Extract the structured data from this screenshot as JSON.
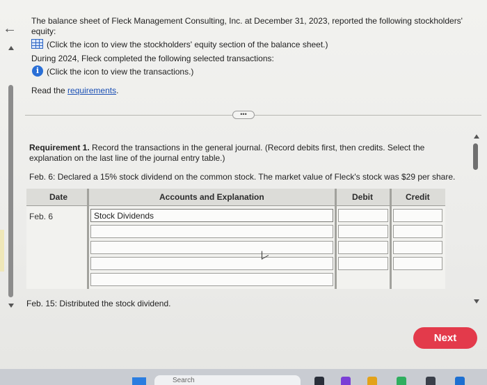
{
  "intro": {
    "line1": "The balance sheet of Fleck Management Consulting, Inc. at December 31, 2023, reported the following stockholders'",
    "line2": "equity:",
    "icon_link1": "(Click the icon to view the stockholders' equity section of the balance sheet.)",
    "line3": "During 2024, Fleck completed the following selected transactions:",
    "icon_link2": "(Click the icon to view the transactions.)",
    "read_prefix": "Read the ",
    "requirements_link": "requirements",
    "read_suffix": "."
  },
  "requirement": {
    "label": "Requirement 1.",
    "text_line1": " Record the transactions in the general journal. (Record debits first, then credits. Select the",
    "text_line2": "explanation on the last line of the journal entry table.)",
    "feb6": "Feb. 6: Declared a 15% stock dividend on the common stock. The market value of Fleck's stock was $29 per share.",
    "feb15": "Feb. 15: Distributed the stock dividend."
  },
  "table": {
    "headers": {
      "date": "Date",
      "accounts": "Accounts and Explanation",
      "debit": "Debit",
      "credit": "Credit"
    },
    "date_value": "Feb. 6",
    "rows": [
      {
        "account": "Stock Dividends",
        "debit": "",
        "credit": ""
      },
      {
        "account": "",
        "debit": "",
        "credit": ""
      },
      {
        "account": "",
        "debit": "",
        "credit": ""
      },
      {
        "account": "",
        "debit": "",
        "credit": ""
      },
      {
        "account": ""
      }
    ]
  },
  "ellipsis": "•••",
  "next_label": "Next",
  "taskbar": {
    "search_text": "Search"
  },
  "colors": {
    "next_button": "#e33a4b",
    "link": "#1a4fb4",
    "info_icon": "#2a6fd6"
  }
}
